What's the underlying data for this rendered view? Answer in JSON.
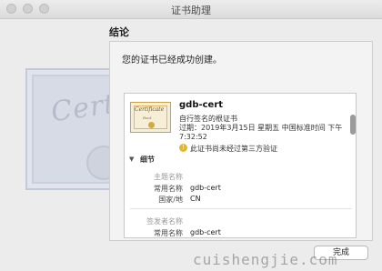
{
  "window": {
    "title": "证书助理"
  },
  "section_title": "结论",
  "message": "您的证书已经成功创建。",
  "certificate": {
    "thumb_title": "Certificate",
    "thumb_subtitle": "Root",
    "name": "gdb-cert",
    "type": "自行签名的根证书",
    "expiry": "过期：2019年3月15日 星期五 中国标准时间 下午7:32:52",
    "warning": "此证书尚未经过第三方验证"
  },
  "details": {
    "label": "细节",
    "subject_header": "主题名称",
    "subject_common_name_key": "常用名称",
    "subject_common_name_value": "gdb-cert",
    "country_key": "国家/地",
    "country_value": "CN",
    "issuer_header": "签发者名称",
    "issuer_common_name_key": "常用名称",
    "issuer_common_name_value": "gdb-cert"
  },
  "buttons": {
    "done": "完成"
  },
  "watermark_text": "cuishengjie.com",
  "background_watermark": "Certif"
}
